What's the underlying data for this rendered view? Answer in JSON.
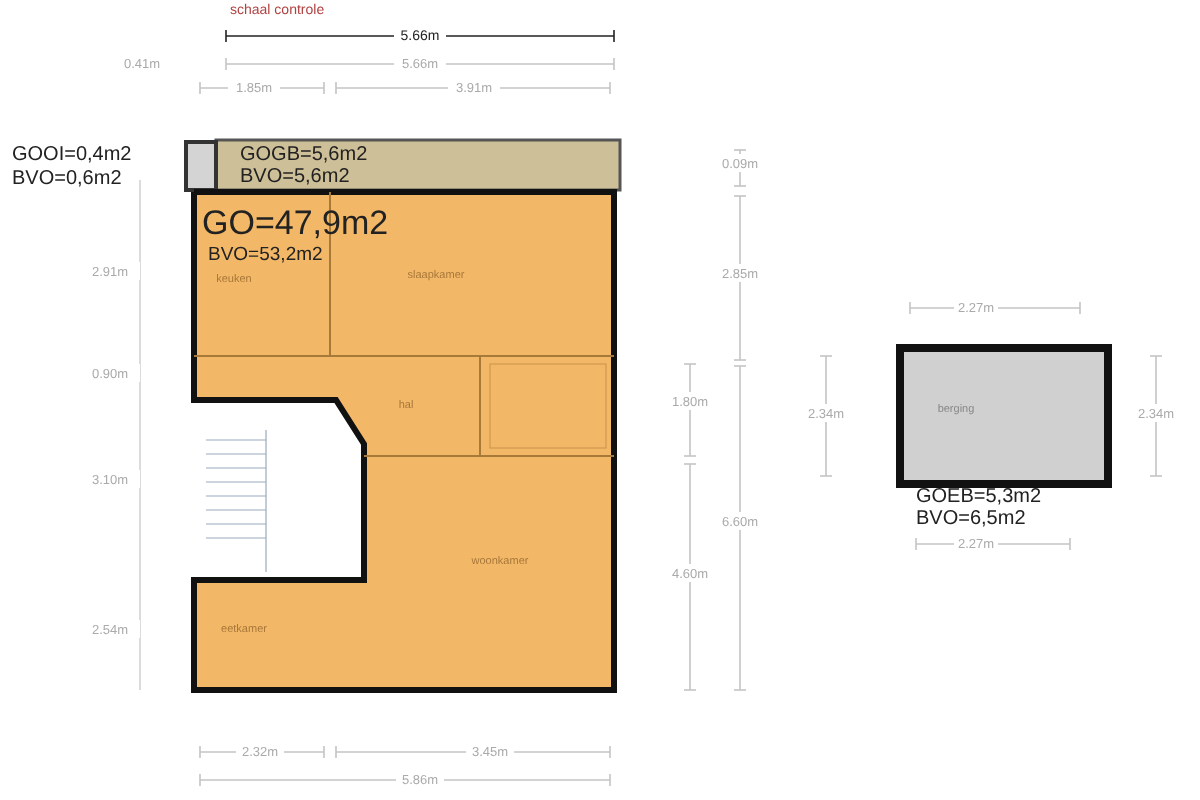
{
  "scale_check": {
    "label": "schaal controle",
    "dimension": "5.66m"
  },
  "dimensions_top": [
    "0.41m",
    "5.66m",
    "1.85m",
    "3.91m"
  ],
  "area_labels": [
    {
      "zone": "GOOI=0,4m2",
      "bvo": "BVO=0,6m2"
    },
    {
      "zone": "GOGB=5,6m2",
      "bvo": "BVO=5,6m2"
    },
    {
      "zone": "GO=47,9m2",
      "bvo": "BVO=53,2m2"
    },
    {
      "zone": "GOEB=5,3m2",
      "bvo": "BVO=6,5m2"
    }
  ],
  "rooms": [
    "keuken",
    "slaapkamer",
    "hal",
    "woonkamer",
    "eetkamer",
    "berging"
  ],
  "dimensions_left": [
    "2.91m",
    "0.90m",
    "3.10m",
    "2.54m"
  ],
  "dimensions_right": [
    "0.09m",
    "2.85m",
    "1.80m",
    "6.60m",
    "4.60m"
  ],
  "dimensions_bottom": [
    "2.32m",
    "3.45m",
    "5.86m"
  ],
  "storage_dimensions": [
    "2.27m",
    "2.34m",
    "2.34m",
    "2.27m"
  ]
}
